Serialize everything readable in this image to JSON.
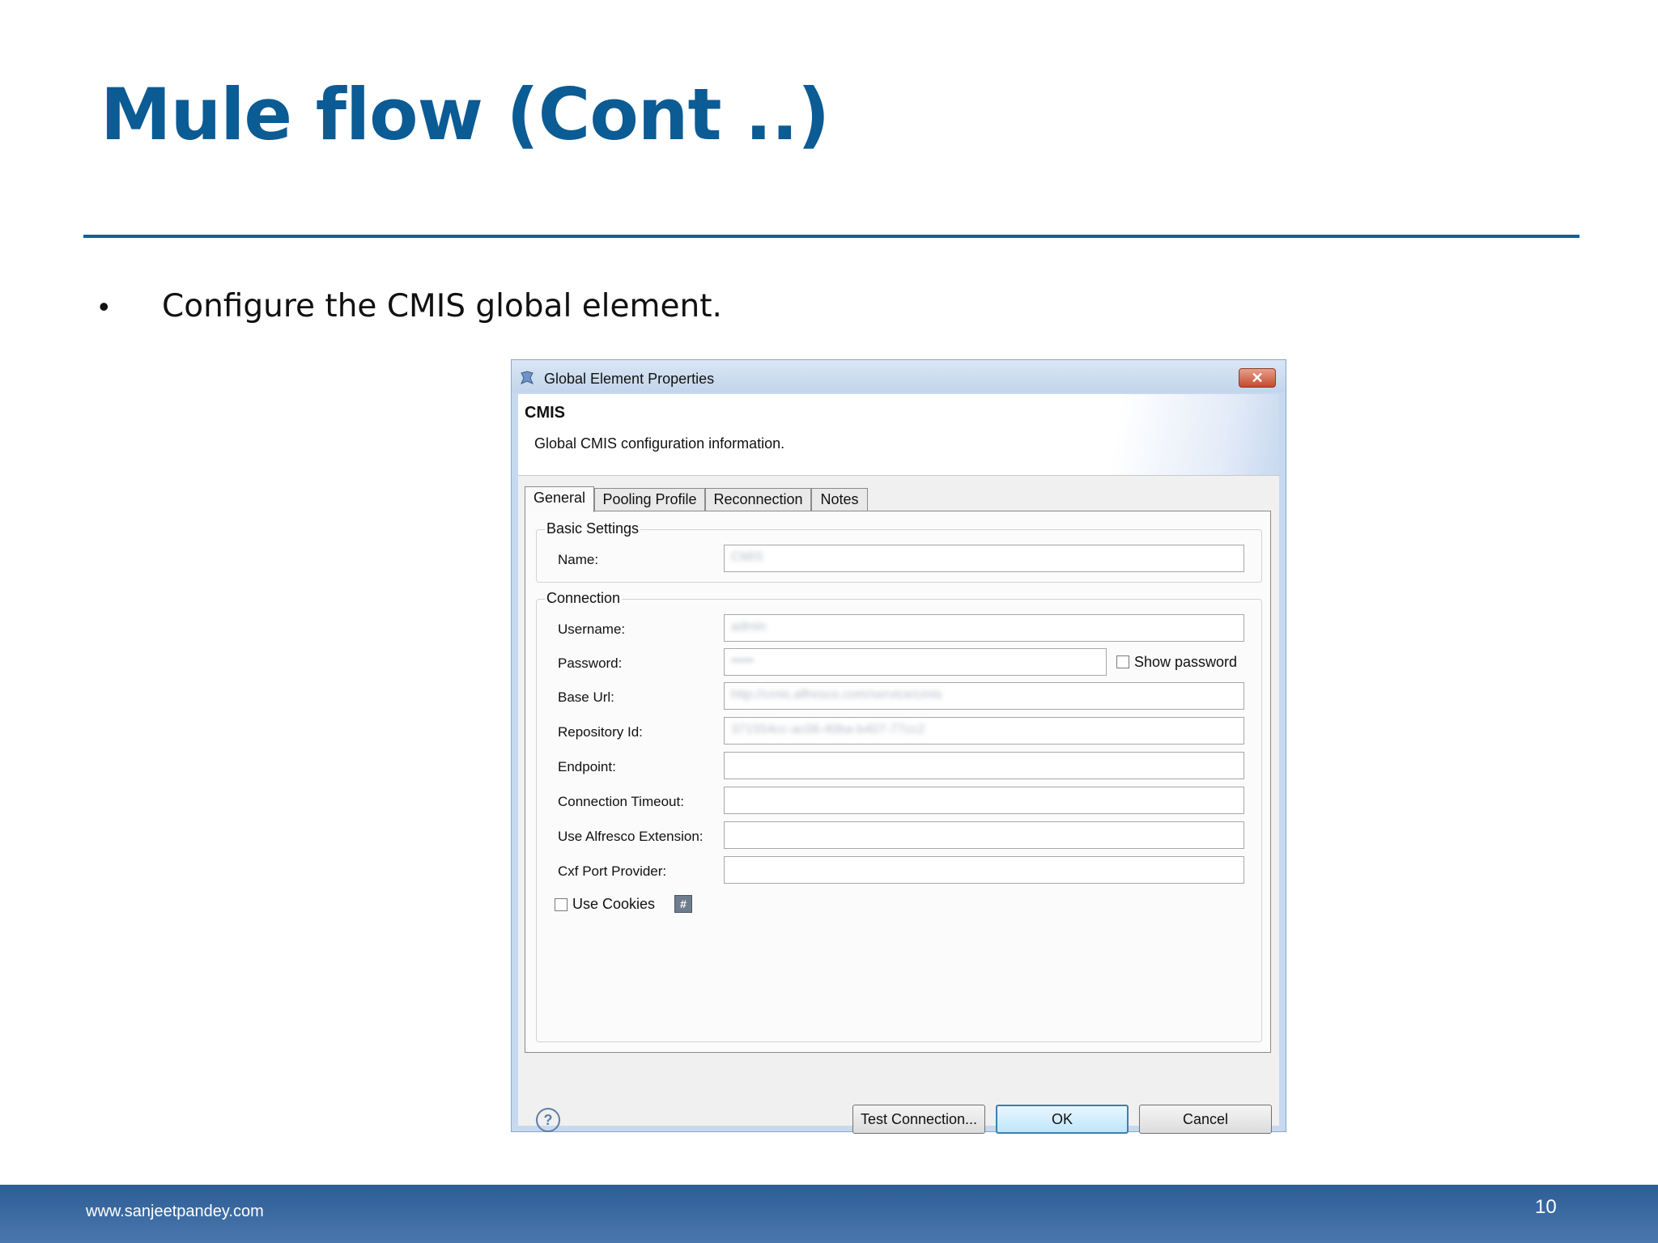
{
  "slide": {
    "title": "Mule flow (Cont ..)",
    "bullet_symbol": "•",
    "bullet_text": "Configure the CMIS global element.",
    "footer_url": "www.sanjeetpandey.com",
    "page_number": "10",
    "colors": {
      "title": "#0b5b94",
      "rule": "#11609a",
      "footer": "#3b6aa2"
    }
  },
  "dialog": {
    "window_title": "Global Element Properties",
    "close_symbol": "✕",
    "header_title": "CMIS",
    "header_subtitle": "Global CMIS configuration information.",
    "tabs": [
      "General",
      "Pooling Profile",
      "Reconnection",
      "Notes"
    ],
    "active_tab": "General",
    "basic_settings": {
      "legend": "Basic Settings",
      "name_label": "Name:",
      "name_value": "CMIS"
    },
    "connection": {
      "legend": "Connection",
      "username_label": "Username:",
      "username_value": "admin",
      "password_label": "Password:",
      "password_value": "•••••",
      "show_password_label": "Show password",
      "base_url_label": "Base Url:",
      "base_url_value": "http://cmis.alfresco.com/service/cmis",
      "repository_id_label": "Repository Id:",
      "repository_id_value": "371554cc-ac06-40ba-b407-77cc2",
      "endpoint_label": "Endpoint:",
      "connection_timeout_label": "Connection Timeout:",
      "use_alfresco_label": "Use Alfresco Extension:",
      "cxf_port_label": "Cxf Port Provider:",
      "use_cookies_label": "Use Cookies",
      "hash_symbol": "#"
    },
    "buttons": {
      "help_symbol": "?",
      "test_connection": "Test Connection...",
      "ok": "OK",
      "cancel": "Cancel"
    }
  }
}
